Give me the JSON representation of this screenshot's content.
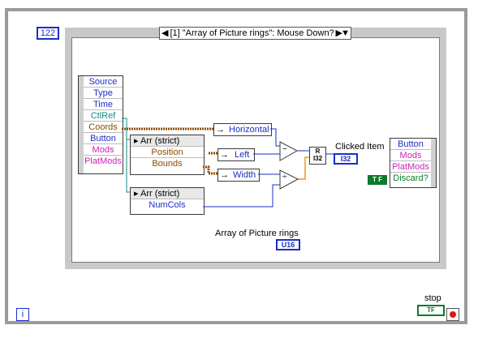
{
  "loop_count": "122",
  "loop_count_icon": "N-count-icon",
  "case_selector": "[1] \"Array of Picture rings\": Mouse Down?",
  "event_data_terminals": [
    {
      "label": "Source",
      "color": "blue"
    },
    {
      "label": "Type",
      "color": "blue"
    },
    {
      "label": "Time",
      "color": "blue"
    },
    {
      "label": "CtlRef",
      "color": "teal"
    },
    {
      "label": "Coords",
      "color": "brown"
    },
    {
      "label": "Button",
      "color": "blue"
    },
    {
      "label": "Mods",
      "color": "pink"
    },
    {
      "label": "PlatMods",
      "color": "pink"
    }
  ],
  "property_node_1": {
    "class": "Arr (strict)",
    "items": [
      "Position",
      "Bounds"
    ]
  },
  "property_node_2": {
    "class": "Arr (strict)",
    "items": [
      "NumCols"
    ]
  },
  "unbundle_labels": {
    "horizontal": "Horizontal",
    "left": "Left",
    "width": "Width"
  },
  "operators": {
    "subtract": "−",
    "divide": "÷"
  },
  "convert_node": "R I32",
  "clicked_item_label": "Clicked Item",
  "clicked_item_type": "I32",
  "array_label": "Array of Picture rings",
  "array_type": "U16",
  "output_terminals": [
    {
      "label": "Button",
      "color": "blue"
    },
    {
      "label": "Mods",
      "color": "pink"
    },
    {
      "label": "PlatMods",
      "color": "pink"
    },
    {
      "label": "Discard?",
      "color": "green"
    }
  ],
  "bool_constant": "T F",
  "stop_label": "stop",
  "stop_type": "TF",
  "iteration_label": "i"
}
